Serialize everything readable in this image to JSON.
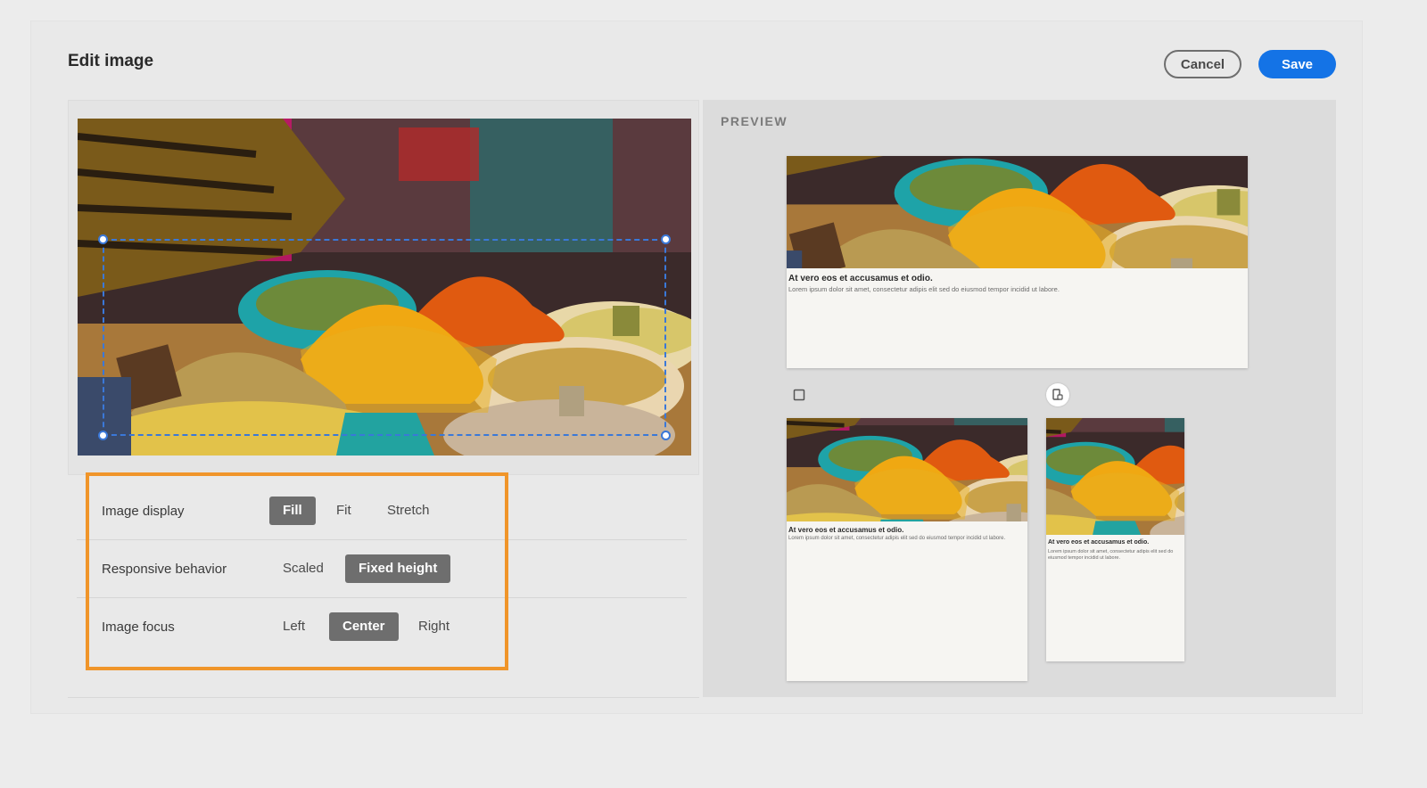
{
  "dialog": {
    "title": "Edit image",
    "cancel_label": "Cancel",
    "save_label": "Save"
  },
  "settings": {
    "image_display": {
      "label": "Image display",
      "options": [
        "Fill",
        "Fit",
        "Stretch"
      ],
      "selected": "Fill"
    },
    "responsive_behavior": {
      "label": "Responsive behavior",
      "options": [
        "Scaled",
        "Fixed height"
      ],
      "selected": "Fixed height"
    },
    "image_focus": {
      "label": "Image focus",
      "options": [
        "Left",
        "Center",
        "Right"
      ],
      "selected": "Center"
    }
  },
  "preview": {
    "label": "PREVIEW",
    "card_title": "At vero eos et accusamus et odio.",
    "card_body": "Lorem ipsum dolor sit amet, consectetur adipis elit sed do eiusmod tempor incidid ut labore.",
    "devices": [
      {
        "icon": "tablet-icon",
        "active": false
      },
      {
        "icon": "mobile-icon",
        "active": true
      }
    ]
  },
  "colors": {
    "accent": "#1473e6",
    "selected_option": "#6e6e6e",
    "highlight": "#f0952a",
    "crop_border": "#3a78d8"
  }
}
